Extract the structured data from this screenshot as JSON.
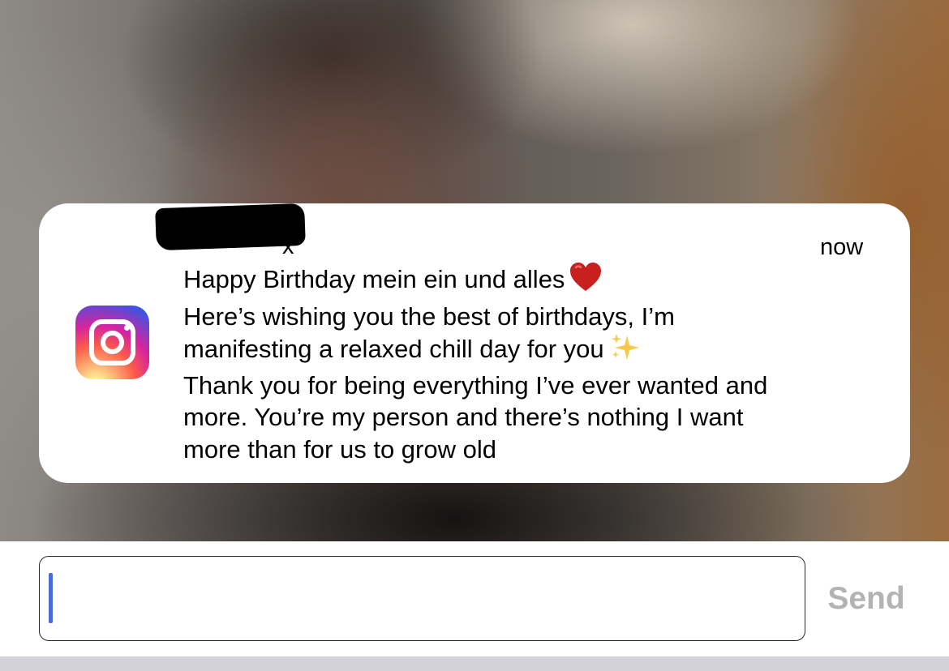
{
  "notification": {
    "app_icon": "instagram-icon",
    "sender_visible": "x",
    "timestamp": "now",
    "message_lines": [
      "Happy Birthday mein ein und alles",
      "Here’s wishing you the best of birthdays, I’m",
      "manifesting a relaxed chill day for you",
      "Thank you for being everything I’ve ever wanted and",
      "more. You’re my person and there’s nothing I want",
      "more than for us to grow old"
    ],
    "emoji_heart": "red-heart-emoji",
    "emoji_sparkles": "sparkles-emoji"
  },
  "reply": {
    "input_value": "",
    "send_label": "Send"
  },
  "colors": {
    "caret": "#4a6bd9",
    "send_disabled": "#b3b3b3"
  }
}
